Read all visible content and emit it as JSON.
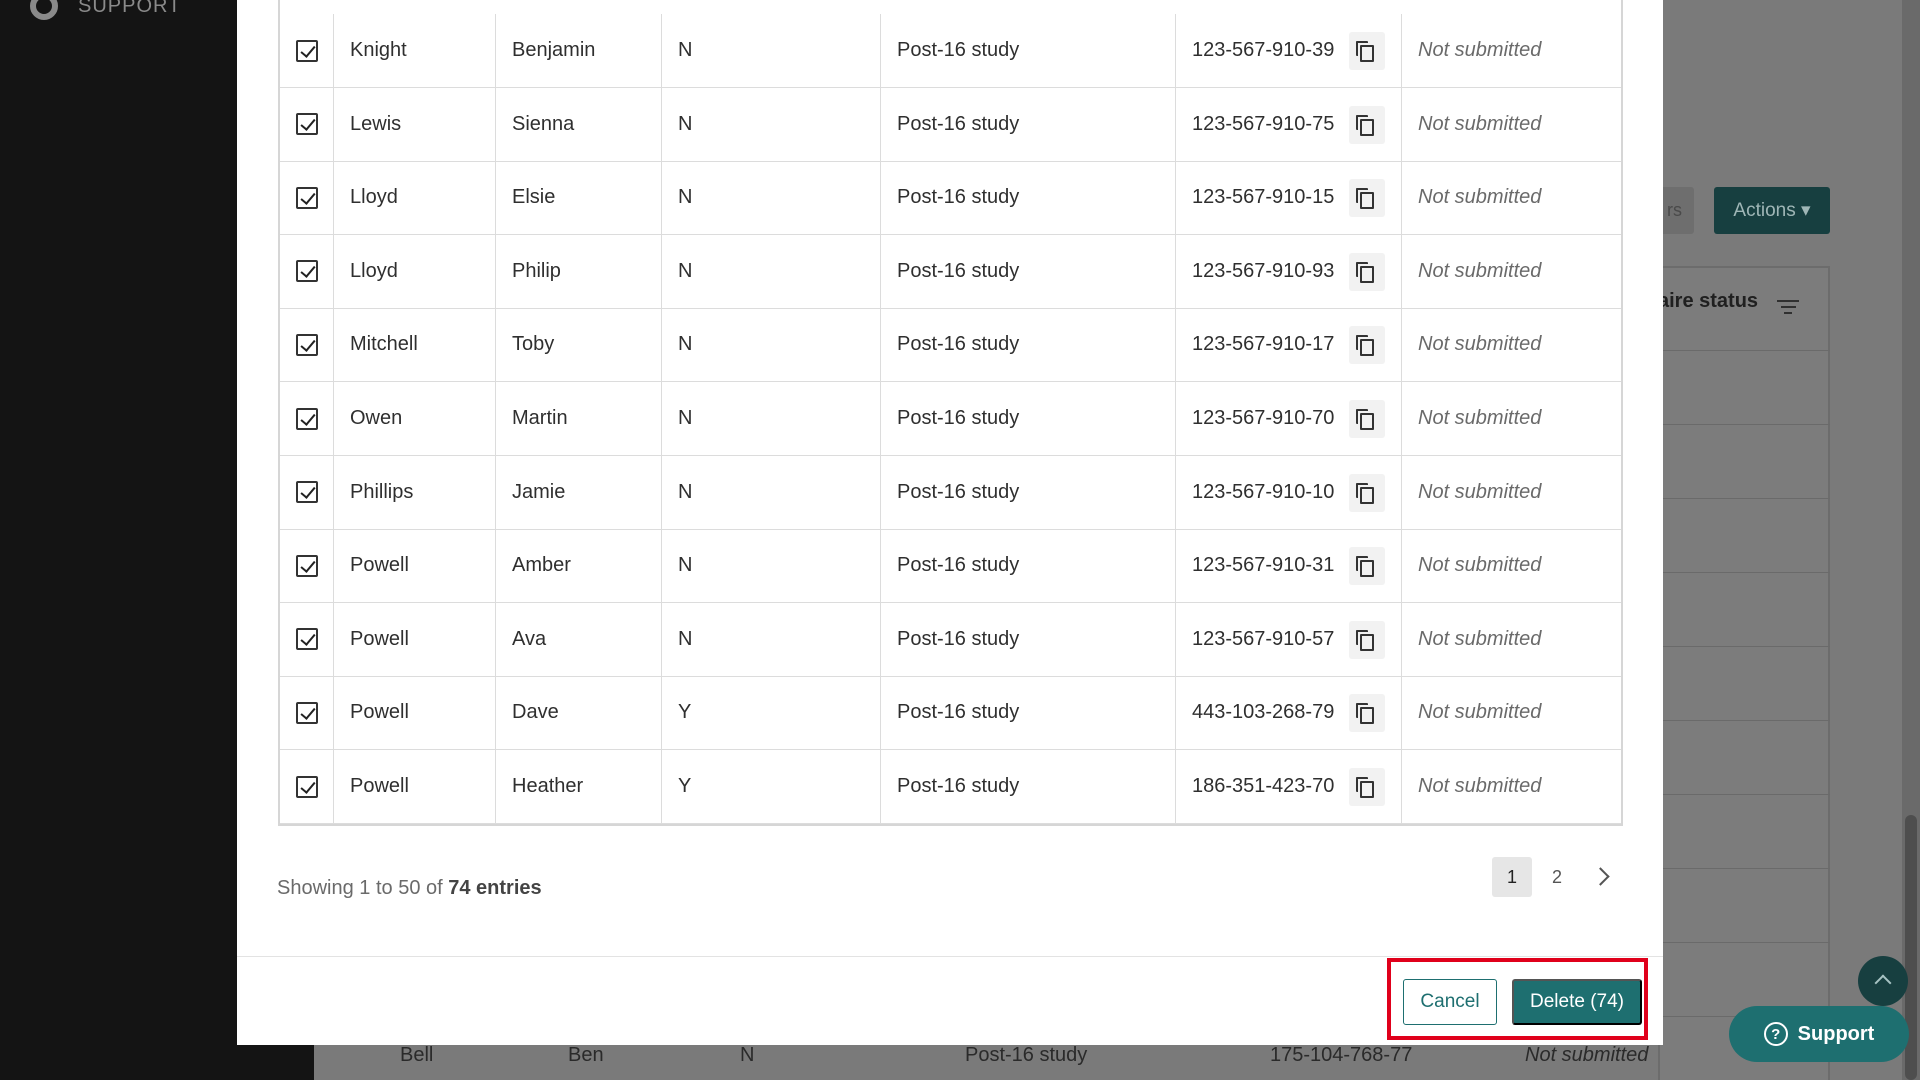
{
  "sidebar": {
    "support_label": "SUPPORT"
  },
  "background": {
    "filters_button_fragment": "rs",
    "actions_label": "Actions",
    "column_header_fragment": "aire status",
    "bottom_row": {
      "last": "Bell",
      "first": "Ben",
      "flag": "N",
      "destination": "Post-16 study",
      "upn": "175-104-768-77",
      "status": "Not submitted"
    }
  },
  "rows": [
    {
      "last": "Knight",
      "first": "Benjamin",
      "flag": "N",
      "destination": "Post-16 study",
      "upn": "123-567-910-39",
      "status": "Not submitted"
    },
    {
      "last": "Lewis",
      "first": "Sienna",
      "flag": "N",
      "destination": "Post-16 study",
      "upn": "123-567-910-75",
      "status": "Not submitted"
    },
    {
      "last": "Lloyd",
      "first": "Elsie",
      "flag": "N",
      "destination": "Post-16 study",
      "upn": "123-567-910-15",
      "status": "Not submitted"
    },
    {
      "last": "Lloyd",
      "first": "Philip",
      "flag": "N",
      "destination": "Post-16 study",
      "upn": "123-567-910-93",
      "status": "Not submitted"
    },
    {
      "last": "Mitchell",
      "first": "Toby",
      "flag": "N",
      "destination": "Post-16 study",
      "upn": "123-567-910-17",
      "status": "Not submitted"
    },
    {
      "last": "Owen",
      "first": "Martin",
      "flag": "N",
      "destination": "Post-16 study",
      "upn": "123-567-910-70",
      "status": "Not submitted"
    },
    {
      "last": "Phillips",
      "first": "Jamie",
      "flag": "N",
      "destination": "Post-16 study",
      "upn": "123-567-910-10",
      "status": "Not submitted"
    },
    {
      "last": "Powell",
      "first": "Amber",
      "flag": "N",
      "destination": "Post-16 study",
      "upn": "123-567-910-31",
      "status": "Not submitted"
    },
    {
      "last": "Powell",
      "first": "Ava",
      "flag": "N",
      "destination": "Post-16 study",
      "upn": "123-567-910-57",
      "status": "Not submitted"
    },
    {
      "last": "Powell",
      "first": "Dave",
      "flag": "Y",
      "destination": "Post-16 study",
      "upn": "443-103-268-79",
      "status": "Not submitted"
    },
    {
      "last": "Powell",
      "first": "Heather",
      "flag": "Y",
      "destination": "Post-16 study",
      "upn": "186-351-423-70",
      "status": "Not submitted"
    }
  ],
  "pagination": {
    "showing_prefix": "Showing 1 to 50 of",
    "total_entries": "74 entries",
    "pages": [
      "1",
      "2"
    ],
    "current_page": "1"
  },
  "footer": {
    "cancel_label": "Cancel",
    "delete_label": "Delete (74)"
  },
  "widgets": {
    "support_label": "Support",
    "support_glyph": "?"
  },
  "colors": {
    "primary": "#1e6f70",
    "highlight": "#e0001b"
  }
}
